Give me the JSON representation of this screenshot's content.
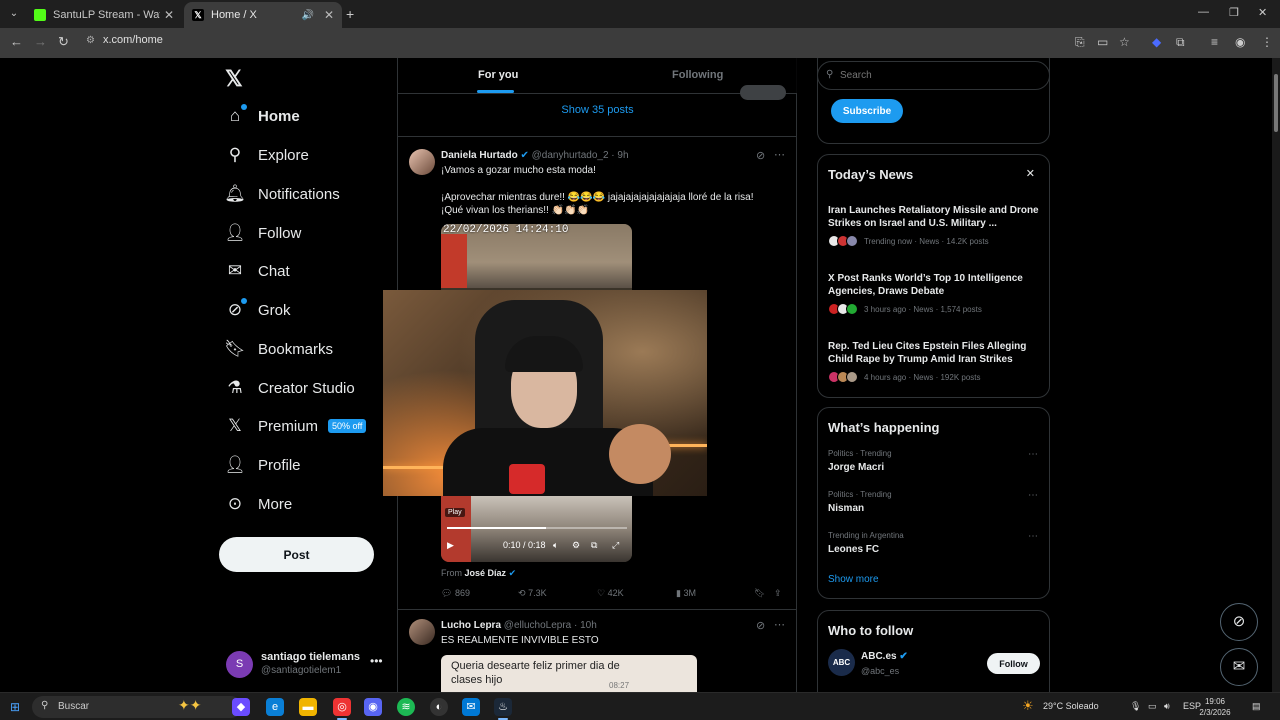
{
  "browser": {
    "tabs": [
      {
        "title": "SantuLP Stream - Watch Live on",
        "favicon_color": "#53fc18",
        "active": false
      },
      {
        "title": "Home / X",
        "favicon_color": "#ffffff",
        "active": true
      }
    ],
    "url": "x.com/home"
  },
  "nav": {
    "logo": "𝕏",
    "items": [
      {
        "label": "Home",
        "icon": "home-icon"
      },
      {
        "label": "Explore",
        "icon": "search-icon"
      },
      {
        "label": "Notifications",
        "icon": "bell-icon"
      },
      {
        "label": "Follow",
        "icon": "person-plus-icon"
      },
      {
        "label": "Chat",
        "icon": "mail-icon"
      },
      {
        "label": "Grok",
        "icon": "grok-icon"
      },
      {
        "label": "Bookmarks",
        "icon": "bookmark-icon"
      },
      {
        "label": "Creator Studio",
        "icon": "flask-icon"
      },
      {
        "label": "Premium",
        "icon": "x-icon"
      },
      {
        "label": "Profile",
        "icon": "person-icon"
      },
      {
        "label": "More",
        "icon": "more-circle-icon"
      }
    ],
    "premium_badge": "50% off",
    "post_label": "Post"
  },
  "account": {
    "initial": "S",
    "name": "santiago tielemans",
    "handle": "@santiagotielem1"
  },
  "feed": {
    "tabs": {
      "for_you": "For you",
      "following": "Following"
    },
    "show_posts": "Show 35 posts",
    "tweet1": {
      "name": "Daniela Hurtado",
      "handle": "@danyhurtado_2",
      "time": "· 9h",
      "line1": "¡Vamos a gozar mucho esta moda!",
      "line2": "¡Aprovechar mientras dure!! 😂😂😂 jajajajajajajajajaja lloré de la risa!",
      "line3": "¡Qué vivan los therians!! 👏🏻👏🏻👏🏻",
      "video_timestamp": "22/02/2026 14:24:10",
      "play_badge": "Play",
      "video_time": "0:10 / 0:18",
      "video_progress": 0.55,
      "from_prefix": "From",
      "from_name": "José Díaz",
      "replies": "869",
      "reposts": "7.3K",
      "likes": "42K",
      "views": "3M"
    },
    "tweet2": {
      "name": "Lucho Lepra",
      "handle": "@elluchoLepra",
      "time": "· 10h",
      "text": "ES REALMENTE INVIVIBLE ESTO",
      "chat_text": "Queria desearte feliz primer dia de clases hijo",
      "chat_time": "08:27"
    }
  },
  "right": {
    "search_placeholder": "Search",
    "subscribe_label": "Subscribe",
    "news_title": "Today’s News",
    "news": [
      {
        "title": "Iran Launches Retaliatory Missile and Drone Strikes on Israel and U.S. Military ...",
        "meta": "Trending now · News · 14.2K posts"
      },
      {
        "title": "X Post Ranks World’s Top 10 Intelligence Agencies, Draws Debate",
        "meta": "3 hours ago · News · 1,574 posts"
      },
      {
        "title": "Rep. Ted Lieu Cites Epstein Files Alleging Child Rape by Trump Amid Iran Strikes",
        "meta": "4 hours ago · News · 192K posts"
      }
    ],
    "happening_title": "What’s happening",
    "trends": [
      {
        "context": "Politics · Trending",
        "name": "Jorge Macri"
      },
      {
        "context": "Politics · Trending",
        "name": "Nisman"
      },
      {
        "context": "Trending in Argentina",
        "name": "Leones FC"
      }
    ],
    "show_more": "Show more",
    "wtf_title": "Who to follow",
    "wtf": {
      "name": "ABC.es",
      "handle": "@abc_es",
      "avatar_text": "ABC",
      "follow": "Follow"
    }
  },
  "taskbar": {
    "search": "Buscar",
    "weather": "29°C  Soleado",
    "lang": "ESP",
    "time": "19:06",
    "date": "2/3/2026"
  }
}
